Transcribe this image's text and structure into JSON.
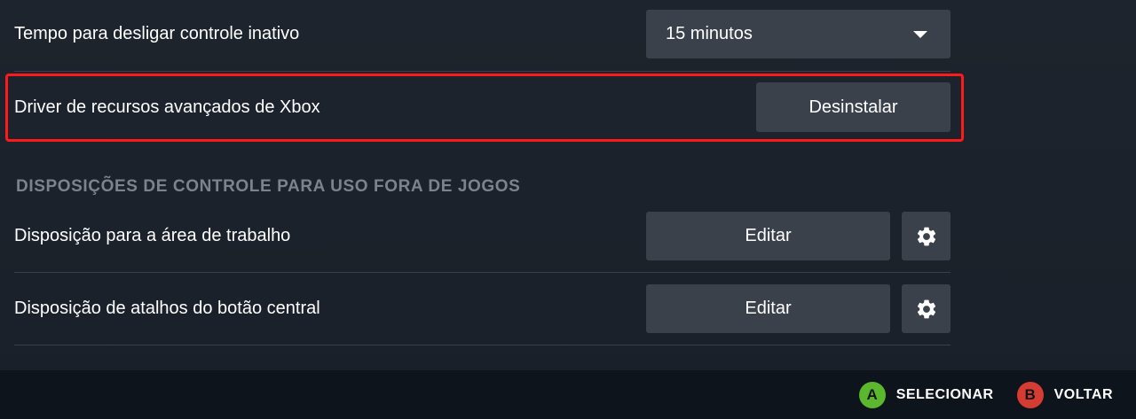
{
  "settings": {
    "idle_timeout": {
      "label": "Tempo para desligar controle inativo",
      "value": "15 minutos"
    },
    "xbox_driver": {
      "label": "Driver de recursos avançados de Xbox",
      "button": "Desinstalar"
    }
  },
  "section": {
    "title": "DISPOSIÇÕES DE CONTROLE PARA USO FORA DE JOGOS"
  },
  "layouts": [
    {
      "label": "Disposição para a área de trabalho",
      "button": "Editar",
      "icon": "gear-icon"
    },
    {
      "label": "Disposição de atalhos do botão central",
      "button": "Editar",
      "icon": "gear-icon"
    }
  ],
  "footer": {
    "select": {
      "glyph": "A",
      "label": "SELECIONAR",
      "color": "#5ab72e"
    },
    "back": {
      "glyph": "B",
      "label": "VOLTAR",
      "color": "#d63c32"
    }
  },
  "colors": {
    "background": "#1b222c",
    "button": "#3a414b",
    "highlight": "#ff1a1a",
    "section_title": "#7c838c"
  }
}
